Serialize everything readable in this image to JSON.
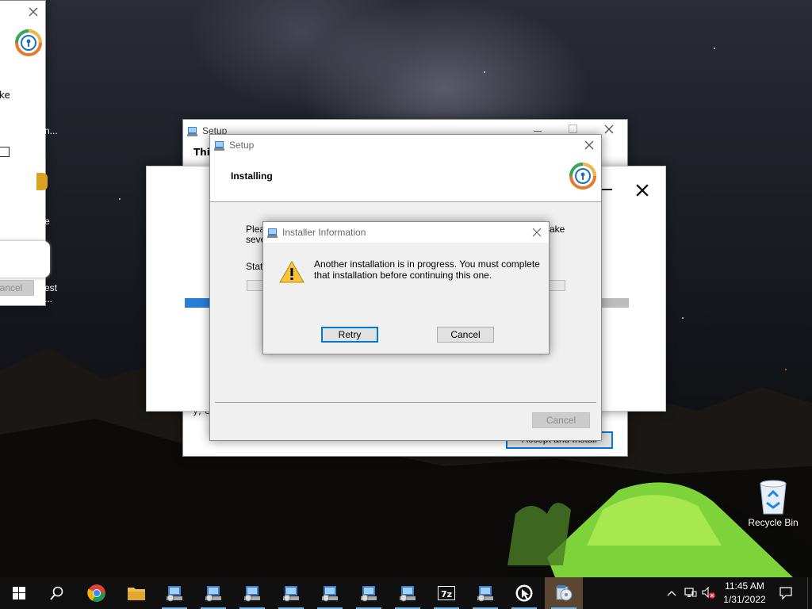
{
  "left_window": {
    "frag_ke": "ke",
    "frag_n": "n...",
    "frag_e": "e",
    "frag_est": "est",
    "frag_dots": "...",
    "cancel_label": "ancel"
  },
  "setup_back": {
    "title": "Setup",
    "heading_fragment": "This",
    "accept_label": "Accept and Install",
    "bottom_fragment": "y, c"
  },
  "setup_front": {
    "title": "Setup",
    "heading": "Installing",
    "please_fragment": "Pleas",
    "seve_fragment": "seve",
    "ake_fragment": "ake",
    "status_fragment": "Statu",
    "cancel_label": "Cancel"
  },
  "dialog": {
    "title": "Installer Information",
    "message_line1": "Another installation is in progress. You must complete",
    "message_line2": "that installation before continuing this one.",
    "retry_label": "Retry",
    "cancel_label": "Cancel"
  },
  "desktop": {
    "recycle_bin_label": "Recycle Bin"
  },
  "taskbar": {
    "time": "11:45 AM",
    "date": "1/31/2022",
    "icons": [
      "windows-start-icon",
      "search-icon",
      "chrome-icon",
      "file-explorer-icon",
      "setup-icon",
      "setup-icon",
      "setup-icon",
      "setup-icon",
      "setup-icon",
      "setup-icon",
      "setup-icon",
      "7zip-icon",
      "setup-icon",
      "cursor-tool-icon",
      "installer-icon"
    ]
  },
  "colors": {
    "accent": "#0078d7",
    "progress_green": "#06b025",
    "taskbar": "#101010"
  }
}
